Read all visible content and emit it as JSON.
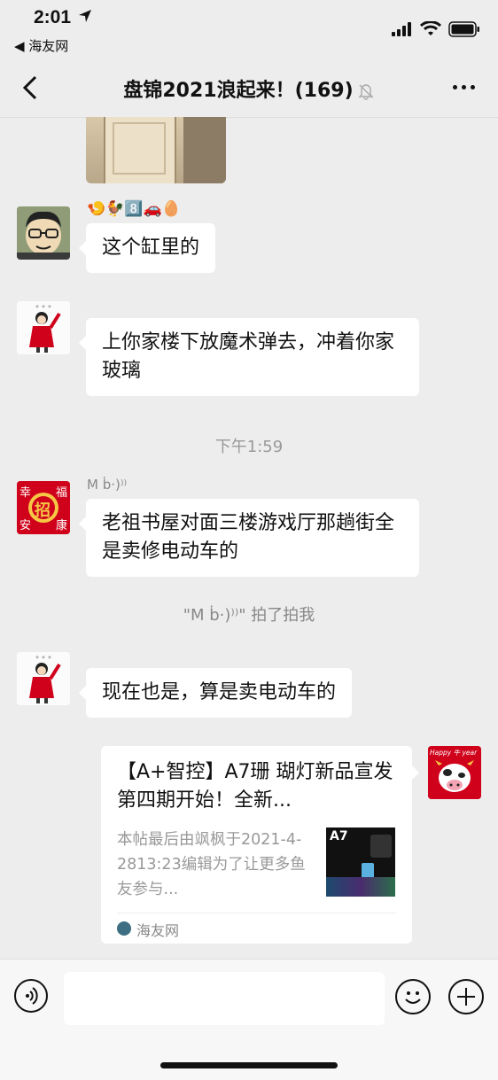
{
  "status": {
    "time": "2:01",
    "back_app": "◀ 海友网"
  },
  "nav": {
    "title": "盘锦2021浪起来！(169)"
  },
  "messages": [
    {
      "sender": "",
      "emoji_name": "🍤🐓8️⃣🚗🥚",
      "text": "这个缸里的"
    },
    {
      "sender": "",
      "text": "上你家楼下放魔术弹去，冲着你家玻璃"
    },
    {
      "sender": "M ḃ·)⁾⁾",
      "text": "老祖书屋对面三楼游戏厅那趟街全是卖修电动车的"
    },
    {
      "sender": "",
      "text": "现在也是，算是卖电动车的"
    }
  ],
  "system": {
    "time_divider": "下午1:59",
    "pat": "\"M ḃ·)⁾⁾\" 拍了拍我"
  },
  "card": {
    "title": "【A+智控】A7珊 瑚灯新品宣发  第四期开始！全新...",
    "desc": "本帖最后由飒枫于2021-4-2813:23编辑为了让更多鱼友参与...",
    "source": "海友网",
    "thumb_label": "A7"
  },
  "avatars": {
    "fortune_chars": [
      "幸",
      "福",
      "安",
      "康"
    ],
    "fortune_center": "招",
    "banner_text": "Happy 牛 year"
  },
  "colors": {
    "background": "#ededed",
    "bubble": "#ffffff",
    "accent": "#d0021b"
  }
}
